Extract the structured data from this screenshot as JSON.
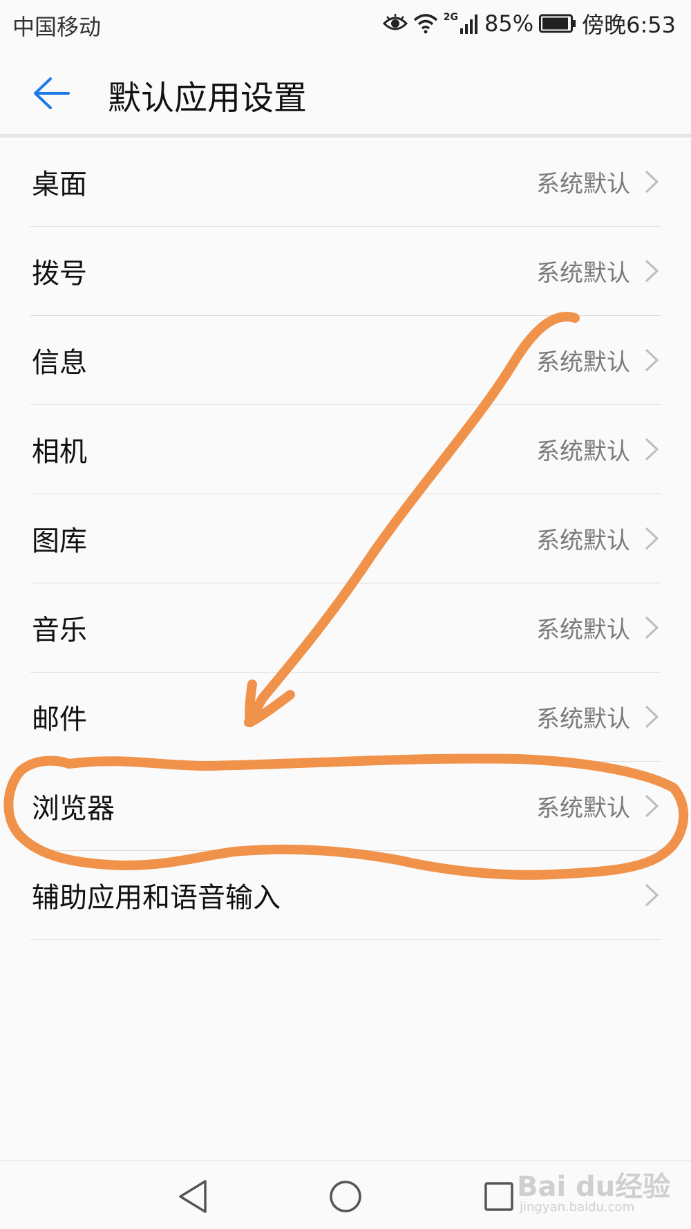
{
  "status_bar": {
    "carrier": "中国移动",
    "network": "2G",
    "battery": "85%",
    "time": "傍晚6:53"
  },
  "header": {
    "title": "默认应用设置"
  },
  "items": [
    {
      "label": "桌面",
      "value": "系统默认"
    },
    {
      "label": "拨号",
      "value": "系统默认"
    },
    {
      "label": "信息",
      "value": "系统默认"
    },
    {
      "label": "相机",
      "value": "系统默认"
    },
    {
      "label": "图库",
      "value": "系统默认"
    },
    {
      "label": "音乐",
      "value": "系统默认"
    },
    {
      "label": "邮件",
      "value": "系统默认"
    },
    {
      "label": "浏览器",
      "value": "系统默认"
    },
    {
      "label": "辅助应用和语音输入",
      "value": ""
    }
  ],
  "watermark": {
    "brand": "Bai du经验",
    "url": "jingyan.baidu.com"
  },
  "colors": {
    "accent": "#1a7ae8",
    "annotation": "#f0924a",
    "value_text": "#7a7a7a"
  }
}
